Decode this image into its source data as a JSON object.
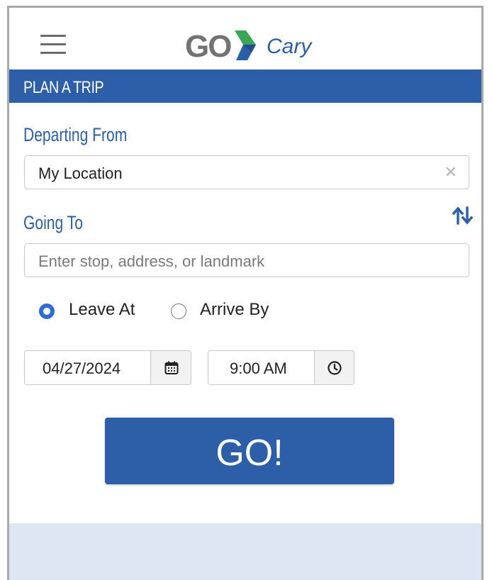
{
  "header": {
    "menu_icon": "hamburger-icon",
    "logo": {
      "go_text": "GO",
      "city_text": "Cary"
    }
  },
  "section_title": "PLAN A TRIP",
  "departing": {
    "label": "Departing From",
    "value": "My Location",
    "clear_icon": "close-icon",
    "clear_glyph": "✕"
  },
  "going_to": {
    "label": "Going To",
    "placeholder": "Enter stop, address, or landmark",
    "swap_icon": "swap-vertical-icon"
  },
  "timing": {
    "options": [
      {
        "label": "Leave At",
        "selected": true
      },
      {
        "label": "Arrive By",
        "selected": false
      }
    ]
  },
  "date": {
    "value": "04/27/2024",
    "icon": "calendar-icon"
  },
  "time": {
    "value": "9:00 AM",
    "icon": "clock-icon"
  },
  "go_button": {
    "label": "GO!"
  },
  "colors": {
    "primary": "#2d5fa8",
    "radio_selected": "#2f6cd8",
    "footer": "#dde6f2",
    "logo_green": "#3aa655",
    "logo_blue": "#2b5ea7"
  }
}
